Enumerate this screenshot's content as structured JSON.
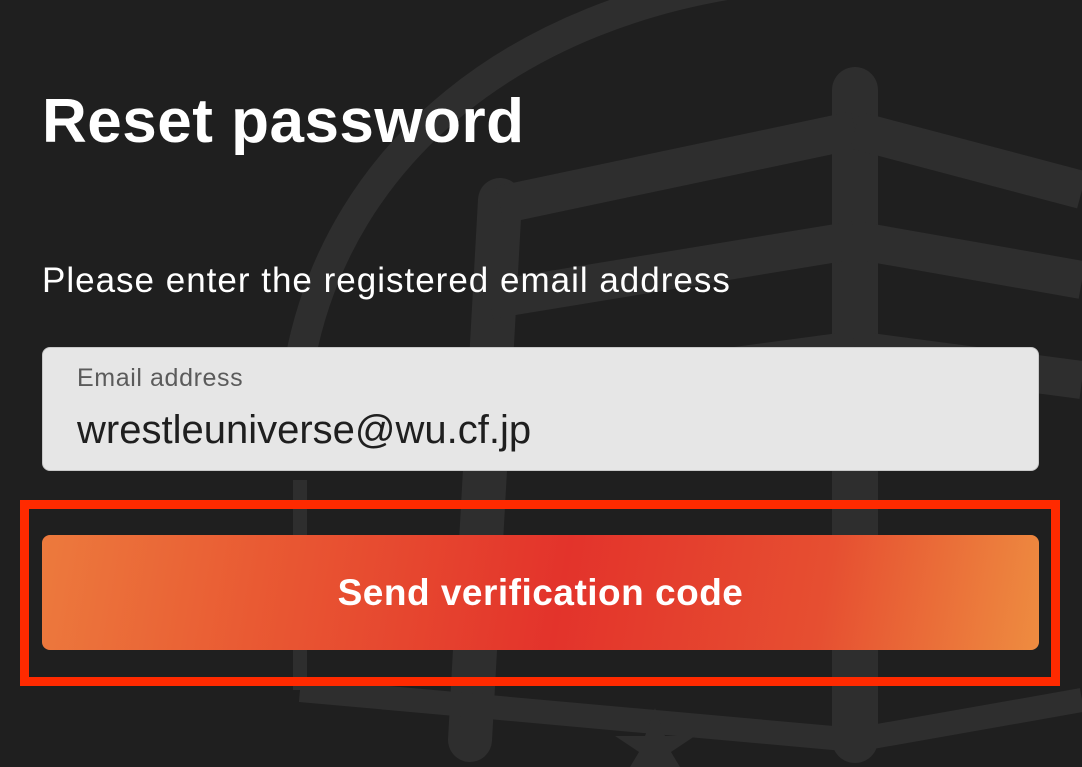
{
  "form": {
    "title": "Reset password",
    "instruction": "Please enter the registered email address",
    "email_label": "Email address",
    "email_value": "wrestleuniverse@wu.cf.jp",
    "submit_label": "Send verification code"
  },
  "colors": {
    "background": "#1f1f1f",
    "button_gradient_start": "#ec7a3d",
    "button_gradient_mid": "#e3332b",
    "button_gradient_end": "#ee8c40",
    "highlight_border": "#ff2a00",
    "input_background": "#e6e6e6"
  },
  "background_graphic": "wrestling-ring-logo-watermark"
}
